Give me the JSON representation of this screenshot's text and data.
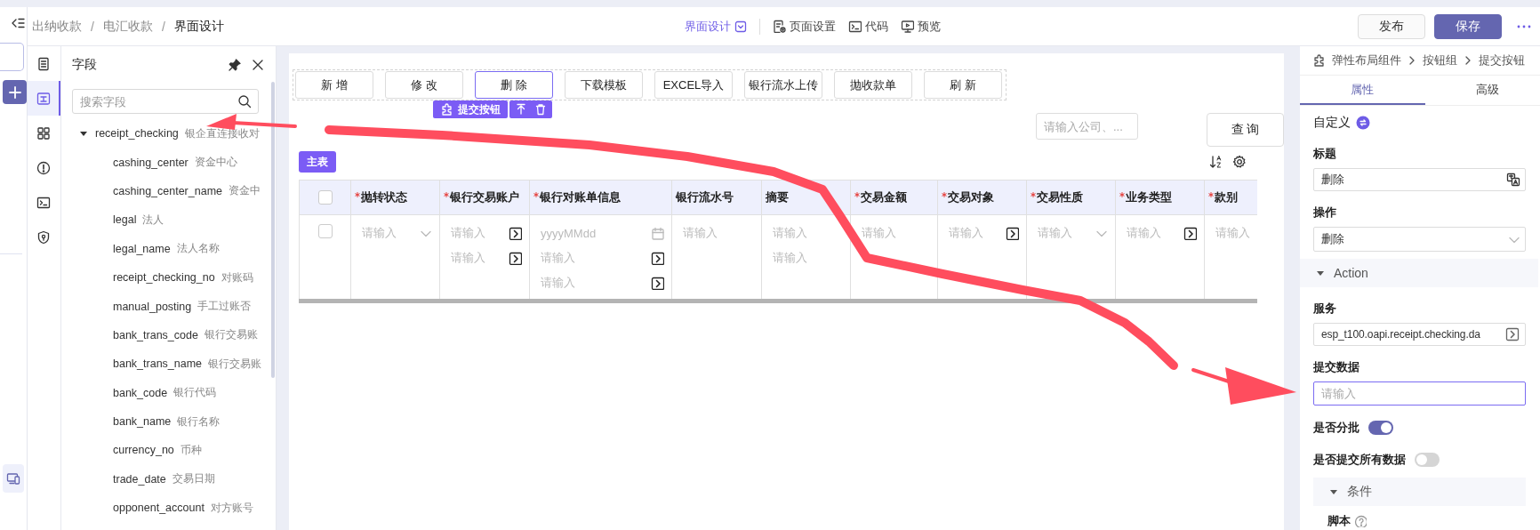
{
  "app_bar": {
    "breadcrumb": [
      {
        "label": "出纳收款",
        "current": false,
        "separator": "/"
      },
      {
        "label": "电汇收款",
        "current": false,
        "separator": "/"
      },
      {
        "label": "界面设计",
        "current": true
      }
    ],
    "mode_tabs": [
      {
        "label": "界面设计",
        "selected": true
      },
      {
        "label": "页面设置",
        "selected": false
      },
      {
        "label": "代码",
        "selected": false
      },
      {
        "label": "预览",
        "selected": false
      }
    ],
    "actions": [
      {
        "label": "发布",
        "kind": "default"
      },
      {
        "label": "保存",
        "kind": "primary"
      }
    ]
  },
  "tool_rail": [
    {
      "selected": false
    },
    {
      "selected": true
    },
    {
      "selected": false
    },
    {
      "selected": false
    },
    {
      "selected": false
    },
    {
      "selected": false
    }
  ],
  "field_panel": {
    "title": "字段",
    "search": {
      "placeholder": "搜索字段"
    },
    "tree": [
      {
        "name": "receipt_checking",
        "label": "银企直连接收对",
        "expanded": true,
        "children": [
          {
            "name": "cashing_center",
            "label": "资金中心"
          },
          {
            "name": "cashing_center_name",
            "label": "资金中"
          },
          {
            "name": "legal",
            "label": "法人"
          },
          {
            "name": "legal_name",
            "label": "法人名称"
          },
          {
            "name": "receipt_checking_no",
            "label": "对账码"
          },
          {
            "name": "manual_posting",
            "label": "手工过账否"
          },
          {
            "name": "bank_trans_code",
            "label": "银行交易账"
          },
          {
            "name": "bank_trans_name",
            "label": "银行交易账"
          },
          {
            "name": "bank_code",
            "label": "银行代码"
          },
          {
            "name": "bank_name",
            "label": "银行名称"
          },
          {
            "name": "currency_no",
            "label": "币种"
          },
          {
            "name": "trade_date",
            "label": "交易日期"
          },
          {
            "name": "opponent_account",
            "label": "对方账号"
          }
        ]
      }
    ]
  },
  "canvas": {
    "toolbar": [
      {
        "label": "新 增",
        "selected": false
      },
      {
        "label": "修 改",
        "selected": false
      },
      {
        "label": "删 除",
        "selected": true
      },
      {
        "label": "下载模板",
        "selected": false
      },
      {
        "label": "EXCEL导入",
        "selected": false
      },
      {
        "label": "银行流水上传",
        "selected": false
      },
      {
        "label": "抛收款单",
        "selected": false
      },
      {
        "label": "刷 新",
        "selected": false
      }
    ],
    "selection_tag": {
      "label": "提交按钮"
    },
    "query": {
      "placeholder": "请输入公司、...",
      "button": "查 询"
    },
    "table": {
      "tag": "主表",
      "header_checked": false,
      "columns": [
        {
          "label": "抛转状态",
          "required": true
        },
        {
          "label": "银行交易账户",
          "required": true
        },
        {
          "label": "银行对账单信息",
          "required": true
        },
        {
          "label": "银行流水号",
          "required": false
        },
        {
          "label": "摘要",
          "required": false
        },
        {
          "label": "交易金额",
          "required": true
        },
        {
          "label": "交易对象",
          "required": true
        },
        {
          "label": "交易性质",
          "required": true
        },
        {
          "label": "业务类型",
          "required": true
        },
        {
          "label": "款别",
          "required": true
        }
      ],
      "rows": [
        {
          "checked": false,
          "cells": [
            [
              {
                "placeholder": "请输入",
                "kind": "select"
              }
            ],
            [
              {
                "placeholder": "请输入",
                "kind": "lookup"
              },
              {
                "placeholder": "请输入",
                "kind": "lookup"
              }
            ],
            [
              {
                "placeholder": "yyyyMMdd",
                "kind": "date"
              },
              {
                "placeholder": "请输入",
                "kind": "lookup"
              },
              {
                "placeholder": "请输入",
                "kind": "lookup"
              }
            ],
            [
              {
                "placeholder": "请输入",
                "kind": "text"
              }
            ],
            [
              {
                "placeholder": "请输入",
                "kind": "text"
              },
              {
                "placeholder": "请输入",
                "kind": "text"
              }
            ],
            [
              {
                "placeholder": "请输入",
                "kind": "text"
              }
            ],
            [
              {
                "placeholder": "请输入",
                "kind": "lookup"
              }
            ],
            [
              {
                "placeholder": "请输入",
                "kind": "select"
              }
            ],
            [
              {
                "placeholder": "请输入",
                "kind": "lookup"
              }
            ],
            [
              {
                "placeholder": "请输入",
                "kind": "text"
              }
            ]
          ]
        }
      ]
    }
  },
  "properties": {
    "breadcrumb": [
      "弹性布局组件",
      "按钮组",
      "提交按钮"
    ],
    "tabs": [
      {
        "label": "属性",
        "selected": true
      },
      {
        "label": "高级",
        "selected": false
      }
    ],
    "items": [
      {
        "kind": "heading",
        "label": "自定义"
      },
      {
        "kind": "input",
        "label": "标题",
        "value": "删除",
        "focused": false
      },
      {
        "kind": "select",
        "label": "操作",
        "value": "删除"
      },
      {
        "kind": "section",
        "label": "Action",
        "expanded": true
      },
      {
        "kind": "lookup",
        "label": "服务",
        "value": "esp_t100.oapi.receipt.checking.da"
      },
      {
        "kind": "input",
        "label": "提交数据",
        "placeholder": "请输入",
        "focused": true
      },
      {
        "kind": "switch",
        "label": "是否分批",
        "on": true
      },
      {
        "kind": "switch",
        "label": "是否提交所有数据",
        "on": false
      },
      {
        "kind": "subsection",
        "label": "条件",
        "expanded": true
      },
      {
        "kind": "help",
        "label": "脚本"
      }
    ]
  }
}
